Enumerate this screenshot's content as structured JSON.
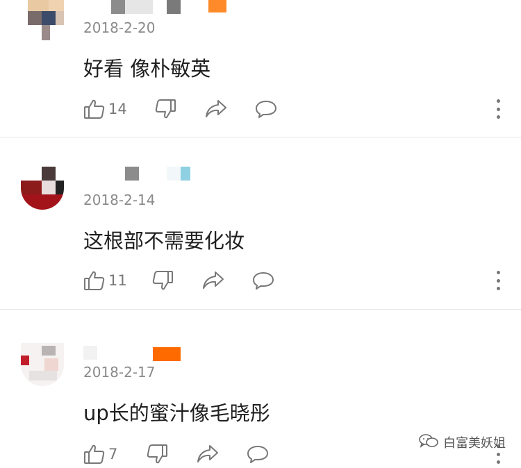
{
  "comments": [
    {
      "date": "2018-2-20",
      "text": "好看 像朴敏英",
      "likes": "14"
    },
    {
      "date": "2018-2-14",
      "text": "这根部不需要化妆",
      "likes": "11"
    },
    {
      "date": "2018-2-17",
      "text": "up长的蜜汁像毛晓彤",
      "likes": "7"
    }
  ],
  "icons": {
    "like": "thumbs-up-icon",
    "dislike": "thumbs-down-icon",
    "share": "share-icon",
    "reply": "comment-icon",
    "more": "more-vertical-icon"
  },
  "watermark": {
    "text": "白富美妖姐"
  },
  "colors": {
    "icon": "#777777",
    "date": "#8a8a8a",
    "divider": "#e6e6e6",
    "badge_orange": "#ff6a00"
  }
}
